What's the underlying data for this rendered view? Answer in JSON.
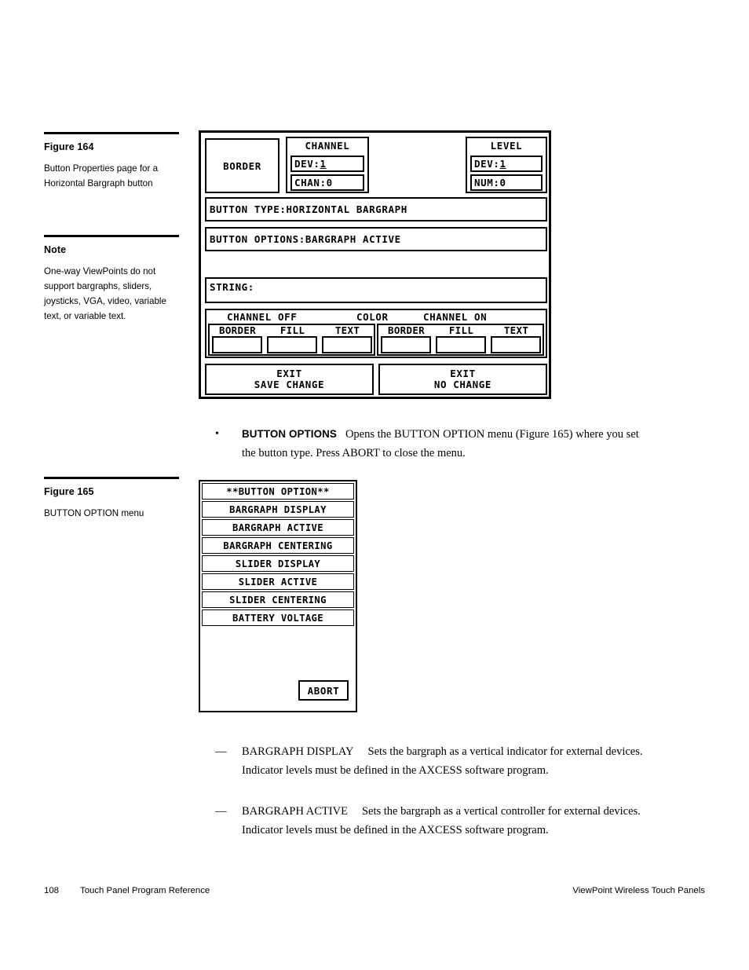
{
  "page": {
    "number": "108",
    "footer_left": "Touch Panel Program Reference",
    "footer_right": "ViewPoint Wireless Touch Panels"
  },
  "margin": {
    "figure164": {
      "heading": "Figure 164",
      "caption": "Button Properties page for a Horizontal Bargraph button"
    },
    "note": {
      "heading": "Note",
      "body": "One-way ViewPoints do not support bargraphs, sliders, joysticks, VGA, video, variable text, or variable text."
    },
    "figure165": {
      "heading": "Figure 165",
      "caption": "BUTTON OPTION menu"
    }
  },
  "figure164": {
    "border_button": "BORDER",
    "channel": {
      "title": "CHANNEL",
      "dev_label": "DEV:",
      "dev_value": "1",
      "chan_label": "CHAN:",
      "chan_value": "0"
    },
    "level": {
      "title": "LEVEL",
      "dev_label": "DEV:",
      "dev_value": "1",
      "num_label": "NUM:",
      "num_value": "0"
    },
    "button_type": "BUTTON TYPE:HORIZONTAL BARGRAPH",
    "button_options": "BUTTON OPTIONS:BARGRAPH ACTIVE",
    "string_field": "STRING:",
    "color_section": {
      "header_off": "CHANNEL OFF",
      "header_color": "COLOR",
      "header_on": "CHANNEL ON",
      "off_columns": [
        "BORDER",
        "FILL",
        "TEXT"
      ],
      "on_columns": [
        "BORDER",
        "FILL",
        "TEXT"
      ],
      "off_swatches": [
        "#ffffff",
        "#ffffff",
        "#ffffff"
      ],
      "on_swatches": [
        "#ffffff",
        "#ffffff",
        "#ffffff"
      ]
    },
    "exit_save": {
      "line1": "EXIT",
      "line2": "SAVE CHANGE"
    },
    "exit_nochange": {
      "line1": "EXIT",
      "line2": "NO CHANGE"
    }
  },
  "figure165": {
    "title": "**BUTTON OPTION**",
    "items": [
      "BARGRAPH DISPLAY",
      "BARGRAPH ACTIVE",
      "BARGRAPH CENTERING",
      "SLIDER DISPLAY",
      "SLIDER ACTIVE",
      "SLIDER CENTERING",
      "BATTERY VOLTAGE"
    ],
    "abort": "ABORT"
  },
  "body": {
    "bullet": {
      "term": "BUTTON OPTIONS",
      "text": "Opens the BUTTON OPTION menu (Figure 165) where you set the button type. Press ABORT to close the menu."
    },
    "dash_items": [
      {
        "term": "BARGRAPH DISPLAY",
        "text": "Sets the bargraph as a vertical indicator for external devices. Indicator levels must be defined in the AXCESS software program."
      },
      {
        "term": "BARGRAPH ACTIVE",
        "text": "Sets the bargraph as a vertical controller for external devices. Indicator levels must be defined in the AXCESS software program."
      }
    ]
  },
  "glyphs": {
    "bullet": "•",
    "emdash": "—"
  }
}
